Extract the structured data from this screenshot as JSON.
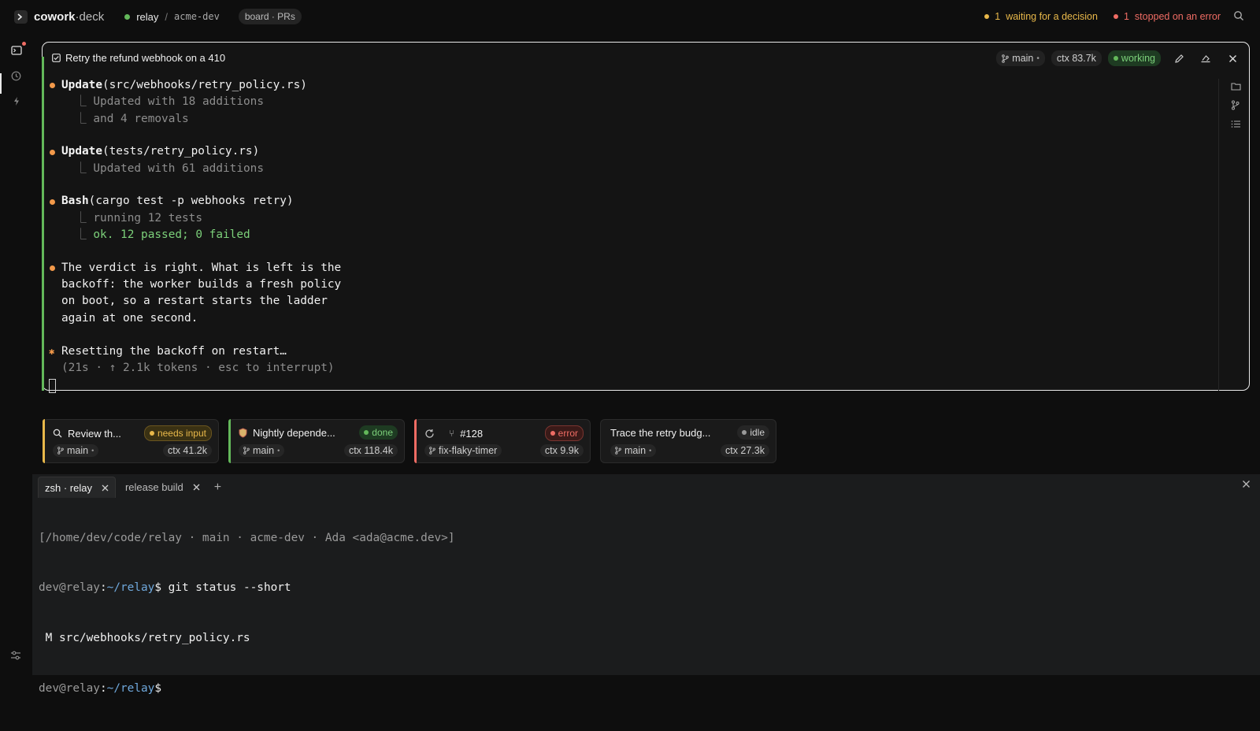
{
  "app": {
    "brand_a": "cowork",
    "brand_b": "·deck",
    "repo": "relay",
    "crumb_sep": "/",
    "workspace": "acme-dev",
    "board_pill": "board · PRs"
  },
  "alerts": {
    "waiting_count": "1",
    "waiting_label": "waiting for a decision",
    "error_count": "1",
    "error_label": "stopped on an error"
  },
  "colors": {
    "accent_green": "#63b85a",
    "orange": "#f2994a",
    "yellow": "#e8b84a",
    "red": "#ef6c64",
    "grey": "#9a9a9a"
  },
  "session": {
    "title": "Retry the refund webhook on a 410",
    "branch": "main",
    "branch_dot": "•",
    "ctx": "ctx 83.7k",
    "status": "working",
    "transcript": [
      {
        "kind": "tool",
        "name": "Update",
        "arg": "(src/webhooks/retry_policy.rs)"
      },
      {
        "kind": "sub",
        "text": "Updated with 18 additions"
      },
      {
        "kind": "sub",
        "text": "and 4 removals"
      },
      {
        "kind": "tool",
        "name": "Update",
        "arg": "(tests/retry_policy.rs)"
      },
      {
        "kind": "sub",
        "text": "Updated with 61 additions"
      },
      {
        "kind": "tool",
        "name": "Bash",
        "arg": "(cargo test -p webhooks retry)"
      },
      {
        "kind": "sub",
        "text": "running 12 tests"
      },
      {
        "kind": "ok",
        "text": "ok. 12 passed; 0 failed"
      },
      {
        "kind": "msg",
        "lines": [
          "The verdict is right. What is left is the",
          "backoff: the worker builds a fresh policy",
          "on boot, so a restart starts the ladder",
          "again at one second."
        ]
      },
      {
        "kind": "spin",
        "text": "Resetting the backoff on restart…",
        "meta": "(21s · ↑ 2.1k tokens · esc to interrupt)"
      }
    ]
  },
  "cards": [
    {
      "title": "Review th...",
      "status": "needs input",
      "branch": "main",
      "ctx": "ctx 41.2k",
      "icon": "search-icon",
      "accent": "#e8b84a"
    },
    {
      "title": "Nightly depende...",
      "status": "done",
      "branch": "main",
      "ctx": "ctx 118.4k",
      "icon": "shield-icon",
      "accent": "#63b85a"
    },
    {
      "title": "#128",
      "status": "error",
      "branch": "fix-flaky-timer",
      "ctx": "ctx 9.9k",
      "icon": "refresh-icon",
      "accent": "#ef6c64"
    },
    {
      "title": "Trace the retry budg...",
      "status": "idle",
      "branch": "main",
      "ctx": "ctx 27.3k",
      "icon": "",
      "accent": ""
    }
  ],
  "terminal": {
    "tabs": [
      "zsh · relay",
      "release build"
    ],
    "add": "+",
    "context_line": "[/home/dev/code/relay · main · acme-dev · Ada <ada@acme.dev>]",
    "prompt_user": "dev@relay",
    "prompt_colon": ":",
    "prompt_path": "~/relay",
    "prompt_sign": "$",
    "cmd": " git status --short",
    "output": " M src/webhooks/retry_policy.rs"
  }
}
